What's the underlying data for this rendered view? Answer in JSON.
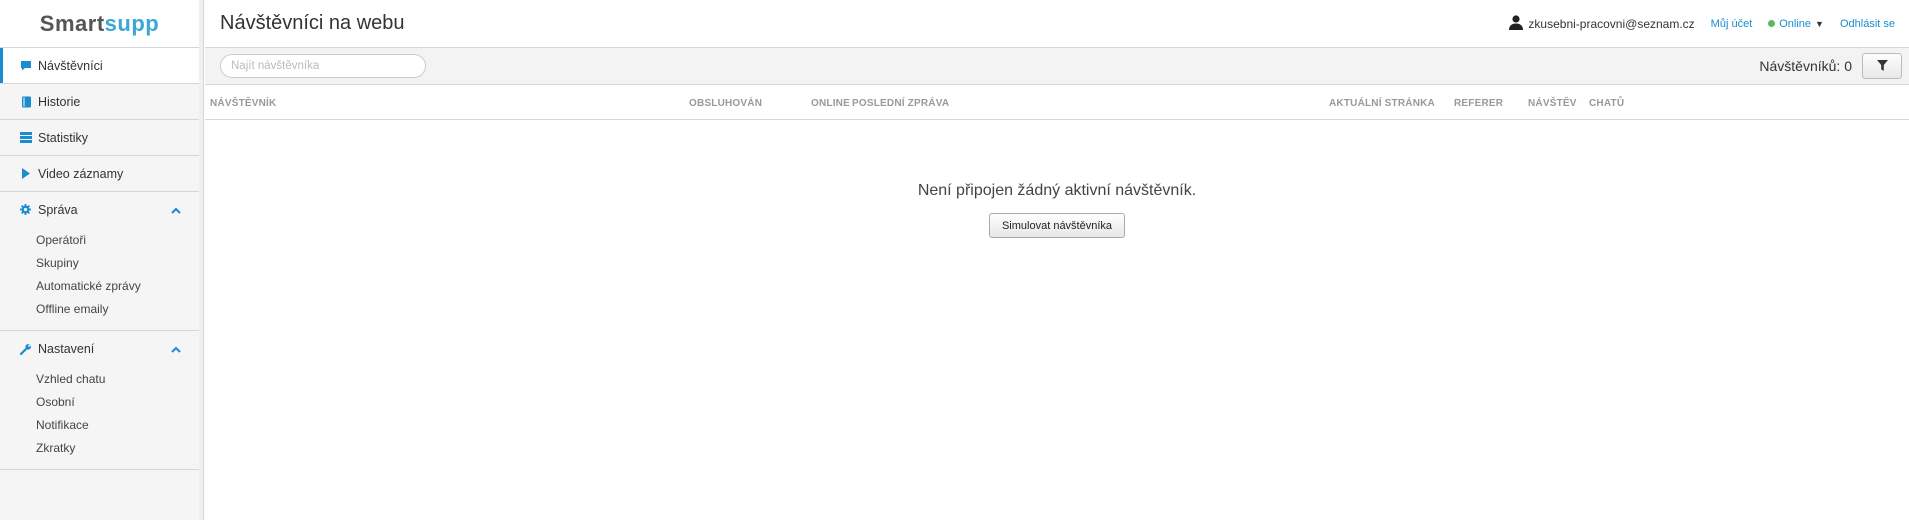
{
  "brand": {
    "part1": "Smart",
    "part2": "supp"
  },
  "sidebar": {
    "items": [
      {
        "label": "Návštěvníci",
        "icon": "chat-bubble-icon"
      },
      {
        "label": "Historie",
        "icon": "book-icon"
      },
      {
        "label": "Statistiky",
        "icon": "table-icon"
      },
      {
        "label": "Video záznamy",
        "icon": "play-icon"
      }
    ],
    "sprava": {
      "label": "Správa",
      "items": [
        "Operátoři",
        "Skupiny",
        "Automatické zprávy",
        "Offline emaily"
      ]
    },
    "nastaveni": {
      "label": "Nastavení",
      "items": [
        "Vzhled chatu",
        "Osobní",
        "Notifikace",
        "Zkratky"
      ]
    }
  },
  "header": {
    "title": "Návštěvníci na webu",
    "user_email": "zkusebni-pracovni@seznam.cz",
    "my_account": "Můj účet",
    "status": "Online",
    "logout": "Odhlásit se"
  },
  "toolbar": {
    "search_placeholder": "Najít návštěvníka",
    "count_label": "Návštěvníků: 0"
  },
  "table": {
    "columns": [
      "NÁVŠTĚVNÍK",
      "OBSLUHOVÁN",
      "ONLINE",
      "POSLEDNÍ ZPRÁVA",
      "AKTUÁLNÍ STRÁNKA",
      "REFERER",
      "NÁVŠTĚV",
      "CHATŮ"
    ]
  },
  "empty": {
    "message": "Není připojen žádný aktivní návštěvník.",
    "simulate_button": "Simulovat návštěvníka"
  },
  "colors": {
    "accent": "#1a8ccf",
    "online": "#5cb85c"
  }
}
